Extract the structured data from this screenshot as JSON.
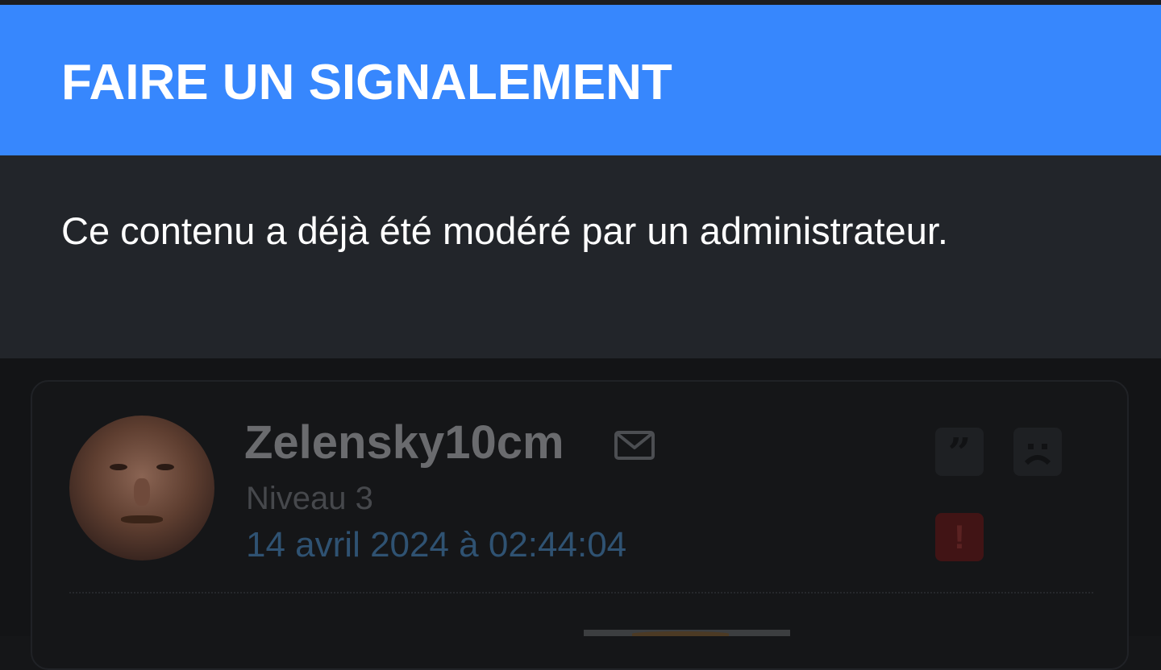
{
  "modal": {
    "title": "FAIRE UN SIGNALEMENT",
    "message": "Ce contenu a déjà été modéré par un administrateur."
  },
  "post": {
    "username": "Zelensky10cm",
    "level": "Niveau 3",
    "date": "14 avril 2024 à 02:44:04",
    "actions": {
      "quote_glyph": "”",
      "alert_glyph": "!"
    }
  },
  "icons": {
    "mail": "mail-icon",
    "quote": "quote-icon",
    "sad": "sad-face-icon",
    "alert": "exclamation-icon"
  },
  "colors": {
    "header_bg": "#3787fd",
    "body_bg": "#22252a",
    "page_bg": "#131416",
    "date_text": "#2f5272",
    "alert_bg": "#411415"
  }
}
